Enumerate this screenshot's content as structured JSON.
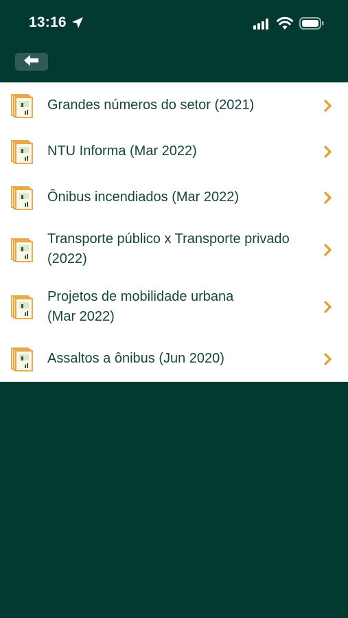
{
  "status": {
    "time": "13:16"
  },
  "nav": {
    "back_icon": "arrow-left-icon"
  },
  "colors": {
    "background": "#023a32",
    "list_background": "#ffffff",
    "text": "#17443e",
    "accent": "#e5a23a"
  },
  "items": [
    {
      "label": "Grandes números do setor (2021)",
      "icon": "document-stack-icon"
    },
    {
      "label": "NTU Informa (Mar 2022)",
      "icon": "document-stack-icon"
    },
    {
      "label": "Ônibus incendiados (Mar 2022)",
      "icon": "document-stack-icon"
    },
    {
      "label": "Transporte público x Transporte privado (2022)",
      "icon": "document-stack-icon"
    },
    {
      "label": "Projetos de mobilidade urbana\n(Mar 2022)",
      "icon": "document-stack-icon"
    },
    {
      "label": "Assaltos a ônibus (Jun 2020)",
      "icon": "document-stack-icon"
    }
  ]
}
